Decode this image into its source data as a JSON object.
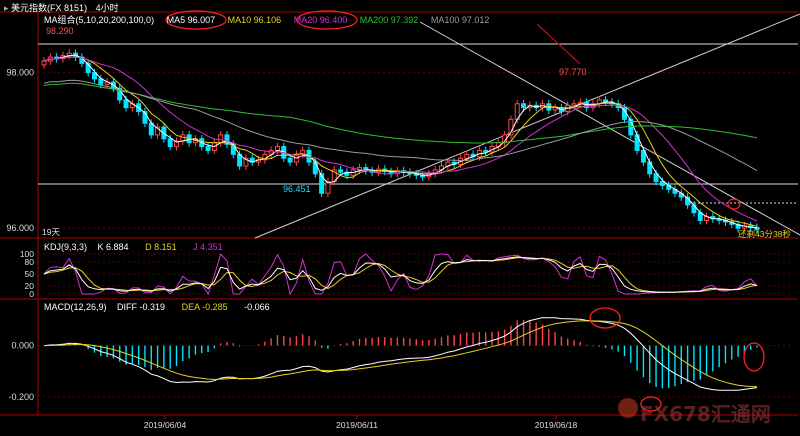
{
  "window": {
    "title": "美元指数(FX 8151)",
    "period": "4小时",
    "expand_icon": "expand-arrow-icon"
  },
  "colors": {
    "ma5": "#ffffff",
    "ma10": "#e6d21e",
    "ma20": "#d033d0",
    "ma200": "#2fbf2f",
    "ma100": "#9a9a9a",
    "up": "#ff4545",
    "down": "#00e5ff",
    "axis": "#b00000",
    "kdj_k": "#ffffff",
    "kdj_d": "#e6d21e",
    "kdj_j": "#d033d0",
    "macd_diff": "#ffffff",
    "macd_dea": "#e6d21e",
    "annotation": "#ff2020"
  },
  "price_panel": {
    "ma_legend": {
      "group": "MA组合(5,10,20,200,100,0)",
      "ma5": "MA5 96.007",
      "ma10": "MA10 96.106",
      "ma20": "MA20 96.400",
      "ma200": "MA200 97.392",
      "ma100": "MA100 97.012"
    },
    "high_label_1": "98.290",
    "high_label_2": "97.770",
    "low_label": "96.451",
    "countdown": "还剩43分38秒",
    "bars_label": "19天",
    "y_ticks": [
      "98.000",
      "96.000"
    ]
  },
  "kdj_panel": {
    "legend": "KDJ(9,3,3)",
    "k": "K 6.884",
    "d": "D 8.151",
    "j": "J 4.351",
    "y_ticks": [
      "100",
      "80",
      "50",
      "20",
      "0"
    ]
  },
  "macd_panel": {
    "legend": "MACD(12,26,9)",
    "diff": "DIFF -0.319",
    "dea": "DEA -0.285",
    "macd": "-0.066",
    "y_ticks": [
      "0.000",
      "-0.200"
    ]
  },
  "x_axis": {
    "ticks": [
      "2019/06/04",
      "2019/06/11",
      "2019/06/18"
    ]
  },
  "watermark": "FX678汇通网",
  "chart_data": [
    {
      "type": "candlestick",
      "title": "美元指数(FX 8151) 4小时",
      "ylim": [
        95.9,
        98.6
      ],
      "x": [
        "2019/06/04",
        "2019/06/11",
        "2019/06/18"
      ],
      "close": [
        98.15,
        98.2,
        98.18,
        98.22,
        98.25,
        98.2,
        98.12,
        98.0,
        97.92,
        97.85,
        97.88,
        97.8,
        97.65,
        97.55,
        97.6,
        97.5,
        97.35,
        97.2,
        97.3,
        97.15,
        97.05,
        97.12,
        97.2,
        97.1,
        97.15,
        97.05,
        97.0,
        97.1,
        97.2,
        97.08,
        96.95,
        96.8,
        96.9,
        96.85,
        96.88,
        96.95,
        97.0,
        97.05,
        96.9,
        96.85,
        96.95,
        97.0,
        96.85,
        96.7,
        96.45,
        96.6,
        96.75,
        96.72,
        96.68,
        96.75,
        96.78,
        96.74,
        96.72,
        96.76,
        96.73,
        96.7,
        96.74,
        96.72,
        96.7,
        96.68,
        96.66,
        96.7,
        96.75,
        96.8,
        96.85,
        96.82,
        96.9,
        96.95,
        96.92,
        97.0,
        96.98,
        97.05,
        97.1,
        97.2,
        97.4,
        97.6,
        97.55,
        97.58,
        97.55,
        97.6,
        97.52,
        97.55,
        97.5,
        97.58,
        97.6,
        97.62,
        97.55,
        97.6,
        97.65,
        97.62,
        97.6,
        97.55,
        97.4,
        97.2,
        97.0,
        96.85,
        96.7,
        96.6,
        96.55,
        96.5,
        96.45,
        96.4,
        96.3,
        96.2,
        96.1,
        96.15,
        96.12,
        96.1,
        96.08,
        96.05,
        96.0,
        96.03,
        96.01,
        95.98
      ],
      "ma_series": [
        {
          "name": "MA5",
          "value": 96.007
        },
        {
          "name": "MA10",
          "value": 96.106
        },
        {
          "name": "MA20",
          "value": 96.4
        },
        {
          "name": "MA200",
          "value": 97.392
        },
        {
          "name": "MA100",
          "value": 97.012
        }
      ],
      "annotations": {
        "high_1": 98.29,
        "high_2": 97.77,
        "low": 96.451
      }
    },
    {
      "type": "line",
      "title": "KDJ(9,3,3)",
      "ylim": [
        0,
        100
      ],
      "series": [
        {
          "name": "K",
          "last": 6.884
        },
        {
          "name": "D",
          "last": 8.151
        },
        {
          "name": "J",
          "last": 4.351
        }
      ]
    },
    {
      "type": "bar",
      "title": "MACD(12,26,9)",
      "ylim": [
        -0.24,
        0.1
      ],
      "series": [
        {
          "name": "DIFF",
          "last": -0.319
        },
        {
          "name": "DEA",
          "last": -0.285
        },
        {
          "name": "MACD",
          "last": -0.066
        }
      ]
    }
  ]
}
